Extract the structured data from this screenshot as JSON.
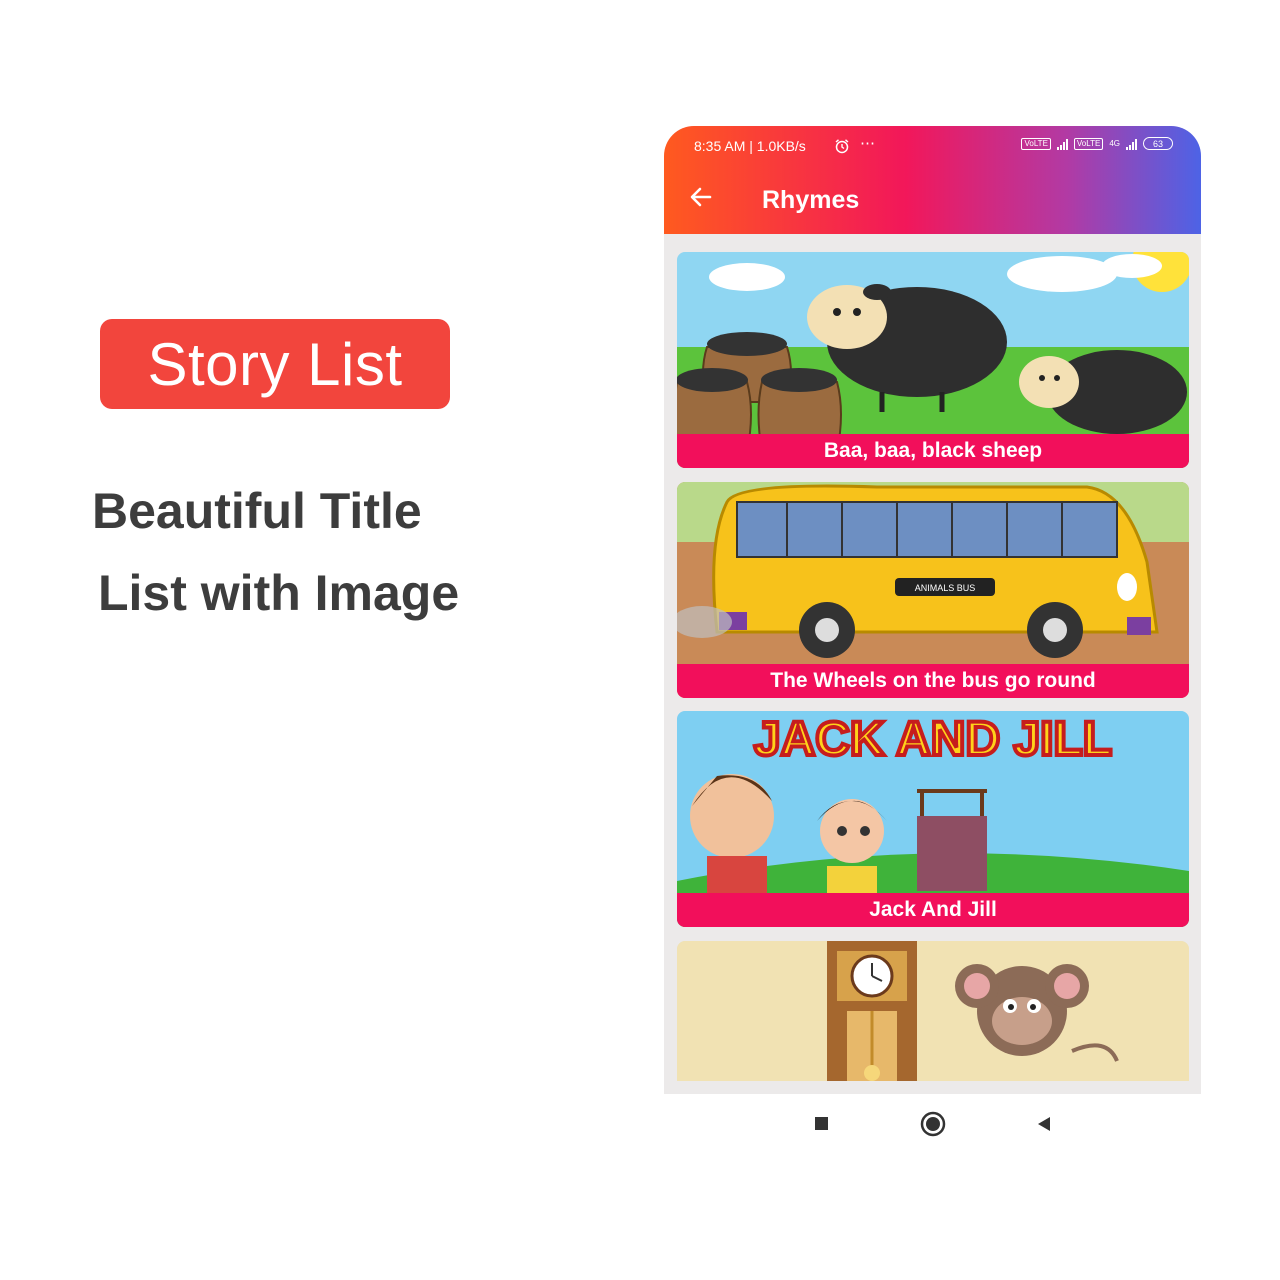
{
  "promo": {
    "badge": "Story List",
    "line1": "Beautiful Title",
    "line2": "List with Image"
  },
  "status_bar": {
    "time": "8:35 AM | 1.0KB/s",
    "alarm_icon": "alarm-clock-icon",
    "more_icon": "⋯",
    "volte_label": "VoLTE",
    "network_label": "4G",
    "battery": "63"
  },
  "appbar": {
    "back_icon": "arrow-left-icon",
    "title": "Rhymes"
  },
  "rhymes": [
    {
      "title": "Baa, baa, black sheep"
    },
    {
      "title": "The Wheels on the bus go round"
    },
    {
      "title": "Jack And Jill"
    },
    {
      "title": ""
    }
  ],
  "artwork_text": {
    "bus_plate": "ANIMALS BUS",
    "jack_and_jill_banner": "JACK AND JILL"
  },
  "nav": {
    "recents_icon": "square-icon",
    "home_icon": "circle-icon",
    "back_icon": "triangle-left-icon"
  },
  "colors": {
    "badge": "#f2453d",
    "caption": "#f20f5b",
    "gradient_start": "#ff5a1f",
    "gradient_end": "#4d63e6"
  }
}
